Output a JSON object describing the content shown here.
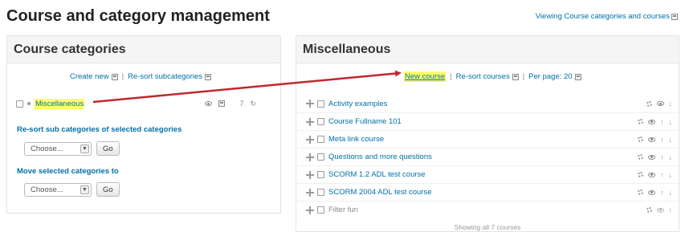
{
  "page": {
    "title": "Course and category management",
    "viewing_label": "Viewing Course categories and courses"
  },
  "categories_panel": {
    "title": "Course categories",
    "create_new": "Create new",
    "separator": "|",
    "resort_subcategories": "Re-sort subcategories",
    "category": {
      "name": "Miscellaneous",
      "course_count": "7"
    },
    "resort_section": {
      "label": "Re-sort sub categories of selected categories",
      "select_value": "Choose...",
      "go_label": "Go"
    },
    "move_section": {
      "label": "Move selected categories to",
      "select_value": "Choose...",
      "go_label": "Go"
    }
  },
  "courses_panel": {
    "title": "Miscellaneous",
    "new_course": "New course",
    "separator": "|",
    "resort_courses": "Re-sort courses",
    "per_page": "Per page: 20",
    "courses": [
      {
        "name": "Activity examples",
        "visible": true
      },
      {
        "name": "Course Fullname 101",
        "visible": true
      },
      {
        "name": "Meta link course",
        "visible": true
      },
      {
        "name": "Questions and more questions",
        "visible": true
      },
      {
        "name": "SCORM 1.2 ADL test course",
        "visible": true
      },
      {
        "name": "SCORM 2004 ADL test course",
        "visible": true
      },
      {
        "name": "Filter fun",
        "visible": false
      }
    ],
    "footer": "Showing all 7 courses"
  },
  "colors": {
    "link": "#0070a8",
    "highlight": "#ffff66",
    "annotation_arrow": "#c0282c"
  }
}
